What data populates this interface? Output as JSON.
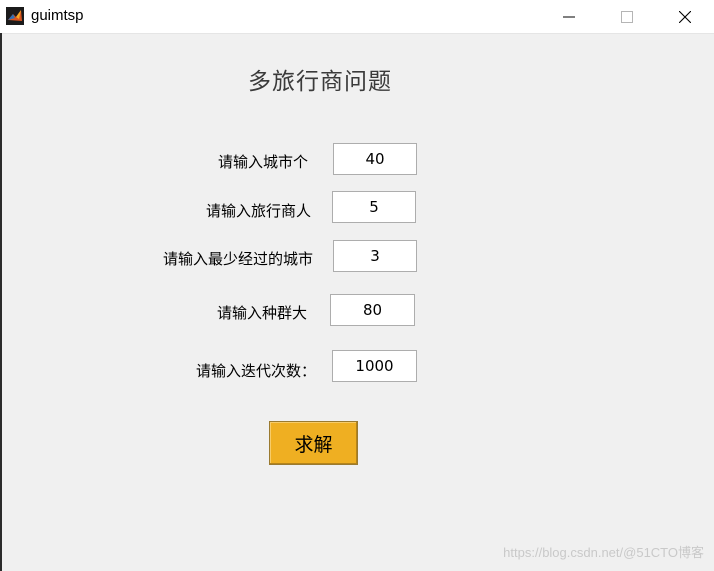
{
  "window": {
    "title": "guimtsp"
  },
  "heading": "多旅行商问题",
  "form": {
    "cities_label": "请输入城市个",
    "cities_value": "40",
    "salesmen_label": "请输入旅行商人",
    "salesmen_value": "5",
    "min_cities_label": "请输入最少经过的城市",
    "min_cities_value": "3",
    "population_label": "请输入种群大",
    "population_value": "80",
    "iterations_label": "请输入迭代次数：",
    "iterations_value": "1000"
  },
  "solve_button": "求解",
  "watermark": "https://blog.csdn.net/@51CTO博客",
  "colors": {
    "button": "#efaf22",
    "background": "#f0f0f0"
  }
}
